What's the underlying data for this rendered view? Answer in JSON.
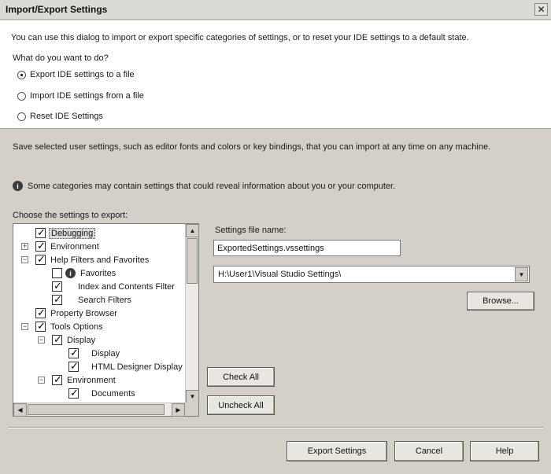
{
  "window": {
    "title": "Import/Export Settings",
    "close_glyph": "✕"
  },
  "intro_text": "You can use this dialog to import or export specific categories of settings, or to reset your IDE settings to a default state.",
  "question_text": "What do you want to do?",
  "options": [
    {
      "label": "Export IDE settings to a file",
      "checked": true
    },
    {
      "label": "Import IDE settings from a file",
      "checked": false
    },
    {
      "label": "Reset IDE Settings",
      "checked": false
    }
  ],
  "description_text": "Save selected user settings, such as editor fonts and colors or key bindings, that you can import at any time on any machine.",
  "info_text": "Some categories may contain settings that could reveal information about you or your computer.",
  "info_icon": "info-icon",
  "choose_label": "Choose the settings to export:",
  "tree": [
    {
      "label": "Debugging",
      "checked": true,
      "expander": "",
      "selected": true
    },
    {
      "label": "Environment",
      "checked": true,
      "expander": "+"
    },
    {
      "label": "Help Filters and Favorites",
      "checked": true,
      "expander": "−"
    },
    {
      "label": "Favorites",
      "checked": false,
      "expander": "",
      "icon": "info-icon"
    },
    {
      "label": "Index and Contents Filter",
      "checked": true,
      "expander": ""
    },
    {
      "label": "Search Filters",
      "checked": true,
      "expander": ""
    },
    {
      "label": "Property Browser",
      "checked": true,
      "expander": ""
    },
    {
      "label": "Tools Options",
      "checked": true,
      "expander": "−"
    },
    {
      "label": "Display",
      "checked": true,
      "expander": "−"
    },
    {
      "label": "Display",
      "checked": true,
      "expander": ""
    },
    {
      "label": "HTML Designer Display",
      "checked": true,
      "expander": ""
    },
    {
      "label": "Environment",
      "checked": true,
      "expander": "−"
    },
    {
      "label": "Documents",
      "checked": true,
      "expander": ""
    }
  ],
  "file_name_label": "Settings file name:",
  "file_name_value": "ExportedSettings.vssettings",
  "folder_path": "H:\\User1\\Visual Studio Settings\\",
  "buttons": {
    "browse": "Browse...",
    "check_all": "Check All",
    "uncheck_all": "Uncheck All",
    "export": "Export Settings",
    "cancel": "Cancel",
    "help": "Help"
  }
}
